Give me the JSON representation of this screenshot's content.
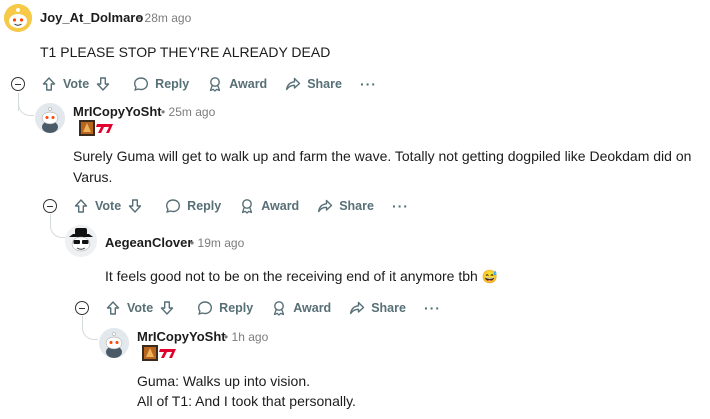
{
  "comments": [
    {
      "author": "Joy_At_Dolmaro",
      "time": "28m ago",
      "body": "T1 PLEASE STOP THEY'RE ALREADY DEAD",
      "actions": {
        "vote": "Vote",
        "reply": "Reply",
        "award": "Award",
        "share": "Share",
        "more": "···"
      }
    },
    {
      "author": "MrICopyYoSht",
      "time": "25m ago",
      "body": "Surely Guma will get to walk up and farm the wave. Totally not getting dogpiled like Deokdam did on Varus.",
      "actions": {
        "vote": "Vote",
        "reply": "Reply",
        "award": "Award",
        "share": "Share",
        "more": "···"
      }
    },
    {
      "author": "AegeanClover",
      "time": "19m ago",
      "body": "It feels good not to be on the receiving end of it anymore tbh",
      "emoji": "😅",
      "actions": {
        "vote": "Vote",
        "reply": "Reply",
        "award": "Award",
        "share": "Share",
        "more": "···"
      }
    },
    {
      "author": "MrICopyYoSht",
      "time": "1h ago",
      "body_lines": [
        "Guma: Walks up into vision.",
        "All of T1: And I took that personally."
      ]
    }
  ],
  "separator": "•",
  "colors": {
    "action": "#576f76",
    "meta": "#7c7c7c",
    "thread": "#d6dbdc",
    "t1_red": "#e2012d"
  }
}
